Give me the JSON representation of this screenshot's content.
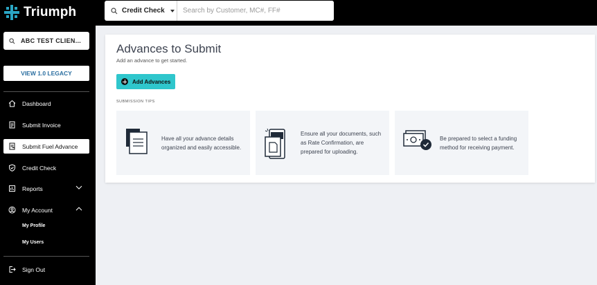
{
  "brand": {
    "name": "Triumph",
    "accent": "#2fc6cc",
    "logo_color": "#2aa6c4"
  },
  "search": {
    "type_label": "Credit Check",
    "placeholder": "Search by Customer, MC#, FF#"
  },
  "sidebar": {
    "client_name": "ABC TEST CLIEN...",
    "legacy_button": "VIEW 1.0 LEGACY",
    "items": [
      {
        "label": "Dashboard",
        "icon": "home-icon"
      },
      {
        "label": "Submit Invoice",
        "icon": "invoice-icon"
      },
      {
        "label": "Submit Fuel Advance",
        "icon": "fuel-advance-icon",
        "active": true
      },
      {
        "label": "Credit Check",
        "icon": "shield-check-icon"
      },
      {
        "label": "Reports",
        "icon": "reports-icon",
        "expandable": true,
        "expanded": false
      },
      {
        "label": "My Account",
        "icon": "account-icon",
        "expandable": true,
        "expanded": true
      }
    ],
    "account_subitems": [
      "My Profile",
      "My Users"
    ],
    "sign_out": "Sign Out"
  },
  "main": {
    "title": "Advances to Submit",
    "subtitle": "Add an advance to get started.",
    "add_button": "Add Advances",
    "tips_label": "SUBMISSION TIPS",
    "tips": [
      {
        "text": "Have all your advance details organized and easily accessible.",
        "icon": "documents-icon"
      },
      {
        "text": "Ensure all your documents, such as Rate Confirmation, are prepared for uploading.",
        "icon": "mobile-scan-icon"
      },
      {
        "text": "Be prepared to select a funding method for receiving payment.",
        "icon": "money-check-icon"
      }
    ]
  }
}
